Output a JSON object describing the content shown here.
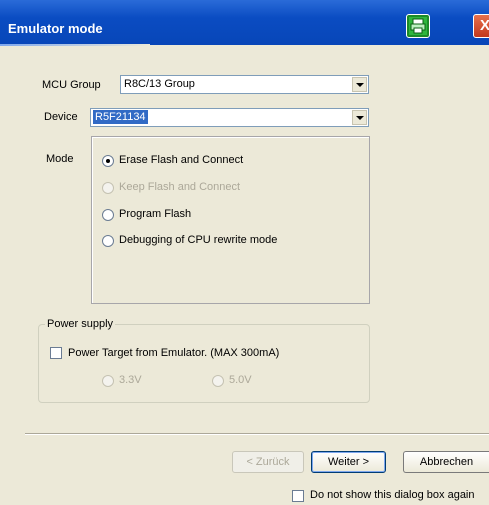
{
  "window": {
    "title": "Emulator mode"
  },
  "icons": {
    "app": "printer-icon",
    "close": "close-icon",
    "close_glyph": "X"
  },
  "mcu_group": {
    "label": "MCU Group",
    "value": "R8C/13 Group"
  },
  "device": {
    "label": "Device",
    "value": "R5F21134"
  },
  "mode": {
    "label": "Mode",
    "options": [
      {
        "label": "Erase Flash and Connect",
        "checked": true,
        "enabled": true
      },
      {
        "label": "Keep Flash and Connect",
        "checked": false,
        "enabled": false
      },
      {
        "label": "Program Flash",
        "checked": false,
        "enabled": true
      },
      {
        "label": "Debugging of CPU rewrite mode",
        "checked": false,
        "enabled": true
      }
    ]
  },
  "power_supply": {
    "caption": "Power supply",
    "checkbox_label": "Power Target from Emulator. (MAX 300mA)",
    "checked": false,
    "voltages": [
      {
        "label": "3.3V",
        "enabled": false
      },
      {
        "label": "5.0V",
        "enabled": false
      }
    ]
  },
  "buttons": {
    "back": "< Zurück",
    "next": "Weiter >",
    "cancel": "Abbrechen"
  },
  "footer": {
    "dont_show_label": "Do not show this dialog box again",
    "checked": false
  },
  "colors": {
    "titlebar": "#0a4cc2",
    "dialog_bg": "#ece9d8",
    "selection": "#316ac5"
  }
}
